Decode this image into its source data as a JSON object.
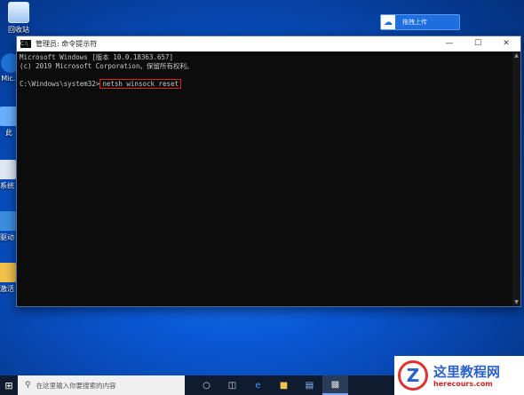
{
  "desktop": {
    "icons": [
      {
        "label": "回收站"
      },
      {
        "label": "Mic…"
      },
      {
        "label": "此"
      },
      {
        "label": "系统"
      },
      {
        "label": "驱动"
      },
      {
        "label": "激活"
      }
    ],
    "cloud_button": {
      "label": "拖拽上传"
    }
  },
  "window": {
    "title": "管理员: 命令提示符",
    "minimize": "—",
    "maximize": "☐",
    "close": "✕",
    "console_line1": "Microsoft Windows [版本 10.0.18363.657]",
    "console_line2": "(c) 2019 Microsoft Corporation。保留所有权利。",
    "prompt": "C:\\Windows\\system32>",
    "command": "netsh winsock reset"
  },
  "taskbar": {
    "search_placeholder": "在这里输入你要搜索的内容"
  },
  "watermark": {
    "logo_letter": "Z",
    "title": "这里教程网",
    "url": "herecours.com"
  }
}
